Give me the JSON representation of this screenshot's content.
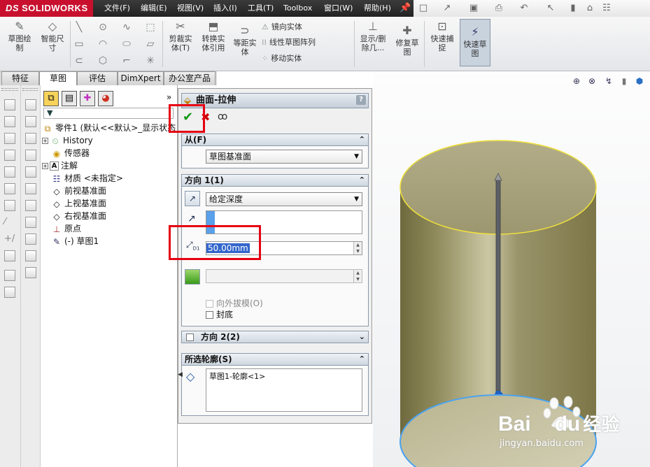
{
  "app": {
    "brand": "SOLIDWORKS",
    "brand_prefix": "DS"
  },
  "menu": [
    "文件(F)",
    "编辑(E)",
    "视图(V)",
    "插入(I)",
    "工具(T)",
    "Toolbox",
    "窗口(W)",
    "帮助(H)"
  ],
  "commands": {
    "sketch": "草图绘\n制",
    "smart_dim": "智能尺\n寸",
    "trim": "剪裁实\n体(T)",
    "convert": "转换实\n体引用",
    "offset": "等距实\n体",
    "mirror": "镜向实体",
    "linear_pattern": "线性草图阵列",
    "move": "移动实体",
    "show_hide": "显示/删\n除几...",
    "repair": "修复草\n图",
    "quick_snap": "快速捕\n捉",
    "rapid_sketch": "快速草\n图"
  },
  "tabs": [
    "特征",
    "草图",
    "评估",
    "DimXpert",
    "办公室产品"
  ],
  "active_tab": "草图",
  "tree": {
    "root": "零件1 (默认<<默认>_显示状态",
    "nodes": [
      "History",
      "传感器",
      "注解",
      "材质 <未指定>",
      "前视基准面",
      "上视基准面",
      "右视基准面",
      "原点",
      "(-) 草图1"
    ]
  },
  "pm": {
    "title": "曲面-拉伸",
    "help": "?",
    "from": {
      "label": "从(F)",
      "value": "草图基准面"
    },
    "dir1": {
      "label": "方向 1(1)",
      "end_condition": "给定深度",
      "depth": "50.00mm",
      "draft_label": "向外拔模(O)",
      "cap_label": "封底"
    },
    "dir2": {
      "label": "方向 2(2)"
    },
    "contours": {
      "label": "所选轮廓(S)",
      "value": "草图1-轮廓<1>"
    }
  },
  "watermark": {
    "brand": "Bai",
    "brand_tail": "du",
    "suffix": "经验",
    "url": "jingyan.baidu.com"
  },
  "colors": {
    "highlight": "#e60012",
    "cylinder": "#a39c6c",
    "selected_edge": "#4aa3f0",
    "top_edge": "#f1e23a"
  }
}
